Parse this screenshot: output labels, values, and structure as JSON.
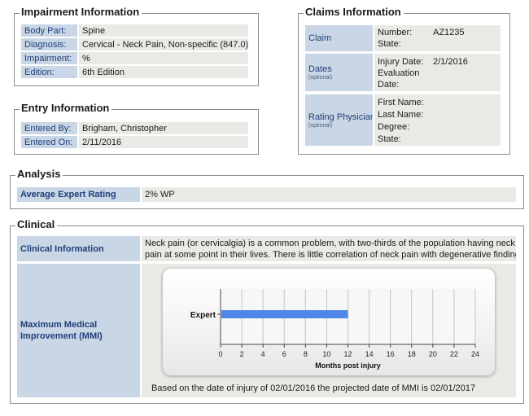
{
  "impairment": {
    "title": "Impairment Information",
    "rows": [
      {
        "label": "Body Part:",
        "value": "Spine"
      },
      {
        "label": "Diagnosis:",
        "value": "Cervical - Neck Pain, Non-specific (847.0)"
      },
      {
        "label": "Impairment:",
        "value": "%"
      },
      {
        "label": "Edition:",
        "value": "6th Edition"
      }
    ]
  },
  "entry": {
    "title": "Entry Information",
    "rows": [
      {
        "label": "Entered By:",
        "value": "Brigham, Christopher"
      },
      {
        "label": "Entered On:",
        "value": "2/11/2016"
      }
    ]
  },
  "claims": {
    "title": "Claims Information",
    "claim_label": "Claim",
    "number_label": "Number:",
    "number_value": "AZ1235",
    "state_label": "State:",
    "dates_label": "Dates",
    "dates_optional": "(optional)",
    "injury_date_label": "Injury Date:",
    "injury_date_value": "2/1/2016",
    "evaluation_label_1": "Evaluation",
    "evaluation_label_2": "Date:",
    "physician_label": "Rating Physician",
    "physician_optional": "(optional)",
    "first_name_label": "First Name:",
    "last_name_label": "Last Name:",
    "degree_label": "Degree:",
    "physician_state_label": "State:"
  },
  "analysis": {
    "title": "Analysis",
    "label": "Average Expert Rating",
    "value": "2% WP"
  },
  "clinical": {
    "title": "Clinical",
    "info_label": "Clinical Information",
    "info_text_1": "Neck pain (or cervicalgia) is a common problem, with two-thirds of the population having neck",
    "info_text_2": "pain at some point in their lives. There is little correlation of neck pain with degenerative findings.",
    "mmi_label_1": "Maximum Medical",
    "mmi_label_2": "Improvement (MMI)",
    "mmi_note": "Based on the date of injury of 02/01/2016 the projected date of MMI is 02/01/2017"
  },
  "chart_data": {
    "type": "bar",
    "orientation": "horizontal",
    "categories": [
      "Expert"
    ],
    "values": [
      12
    ],
    "xlabel": "Months post injury",
    "ylabel": "",
    "xlim": [
      0,
      24
    ],
    "xticks": [
      0,
      2,
      4,
      6,
      8,
      10,
      12,
      14,
      16,
      18,
      20,
      22,
      24
    ],
    "grid": true,
    "bar_color": "#4f86e8"
  }
}
